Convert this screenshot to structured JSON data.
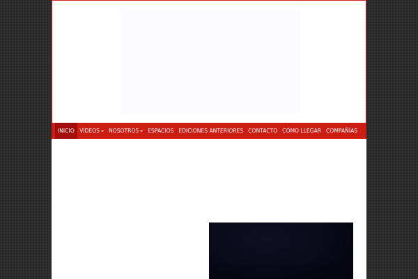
{
  "nav": {
    "items": [
      {
        "label": "INICIO",
        "active": true,
        "dropdown": false
      },
      {
        "label": "VÍDEOS",
        "active": false,
        "dropdown": true
      },
      {
        "label": "NOSOTROS",
        "active": false,
        "dropdown": true
      },
      {
        "label": "ESPACIOS",
        "active": false,
        "dropdown": false
      },
      {
        "label": "EDICIONES ANTERIORES",
        "active": false,
        "dropdown": false
      },
      {
        "label": "CONTACTO",
        "active": false,
        "dropdown": false
      },
      {
        "label": "CÓMO LLEGAR",
        "active": false,
        "dropdown": false
      },
      {
        "label": "COMPAÑÍAS",
        "active": false,
        "dropdown": false
      }
    ]
  },
  "colors": {
    "nav_background": "#cd1c12",
    "nav_active": "#a50f0b",
    "page_background": "#2b2b2b"
  }
}
